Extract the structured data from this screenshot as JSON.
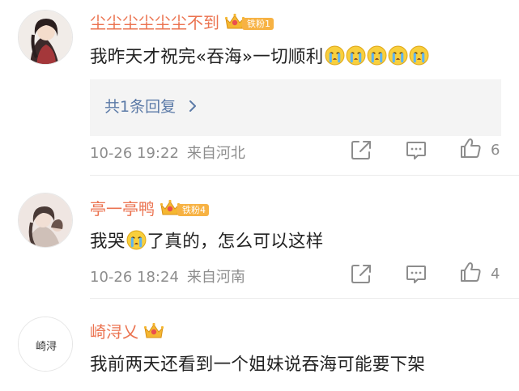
{
  "comments": [
    {
      "username": "尘尘尘尘尘尘不到",
      "fan_badge": "铁粉1",
      "text": "我昨天才祝完«吞海»一切顺利",
      "emoji_count": 5,
      "emoji_name": "crying-face-icon",
      "reply_link": "共1条回复",
      "timestamp": "10-26 19:22",
      "location": "来自河北",
      "likes": "6"
    },
    {
      "username": "亭一亭鸭",
      "fan_badge": "铁粉4",
      "text_before": "我哭",
      "text_after": "了真的，怎么可以这样",
      "emoji_name": "crying-face-icon",
      "timestamp": "10-26 18:24",
      "location": "来自河南",
      "likes": "4"
    },
    {
      "username": "崎浔乂",
      "text": "我前两天还看到一个姐妹说吞海可能要下架"
    }
  ],
  "icons": {
    "share": "share-icon",
    "comment": "comment-icon",
    "like": "thumbs-up-icon",
    "crown": "crown-icon",
    "reply_chevron": "chevron-right-icon"
  },
  "colors": {
    "username": "#eb7350",
    "reply_link": "#5b7aa7",
    "meta_gray": "#8d8d8d",
    "badge_orange": "#f7b243",
    "reply_bg": "#f4f4f4"
  }
}
